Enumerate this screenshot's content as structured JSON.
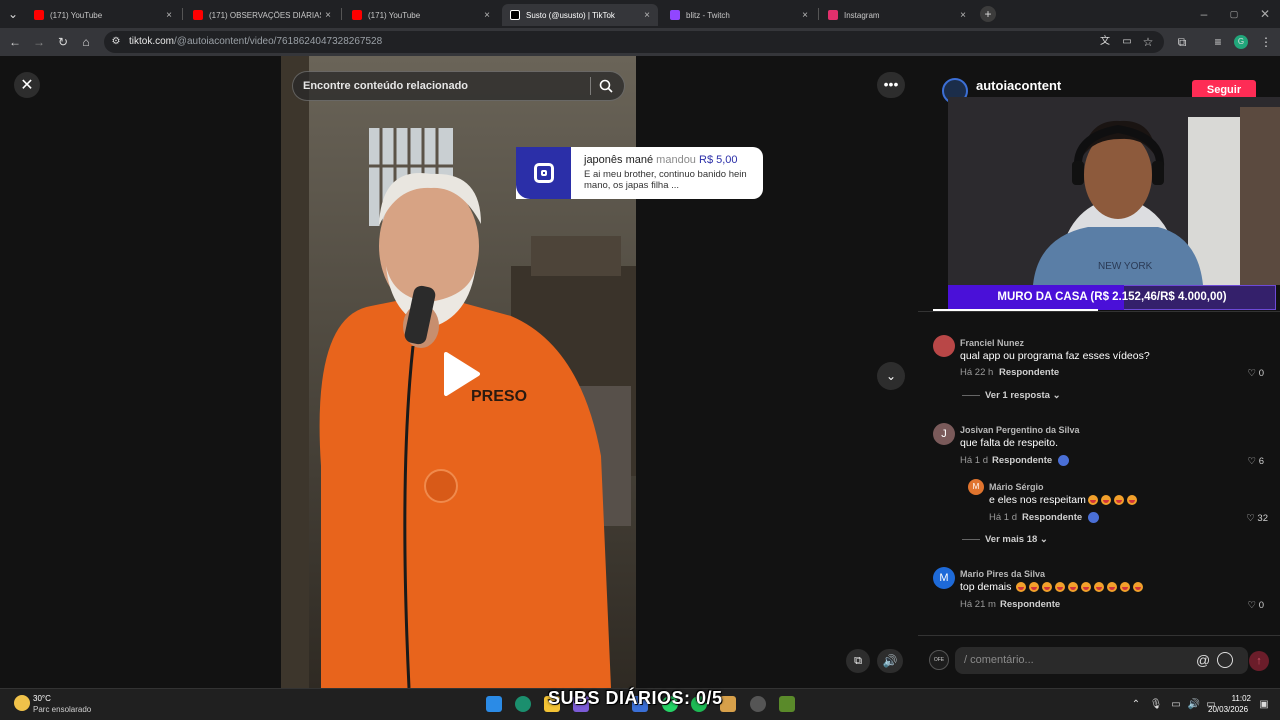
{
  "browser": {
    "tabs": [
      {
        "title": "(171) YouTube",
        "color": "#ff0000",
        "active": false
      },
      {
        "title": "(171) OBSERVAÇÕES DIÁRIAS |",
        "color": "#ff0000",
        "active": false
      },
      {
        "title": "(171) YouTube",
        "color": "#ff0000",
        "active": false
      },
      {
        "title": "Susto (@ususto) | TikTok",
        "color": "#000000",
        "active": true
      },
      {
        "title": "blitz - Twitch",
        "color": "#9146ff",
        "active": false
      },
      {
        "title": "Instagram",
        "color": "#e1306c",
        "active": false
      }
    ],
    "url_host": "tiktok.com",
    "url_path": "/@autoiacontent/video/7618624047328267528"
  },
  "video": {
    "search_placeholder": "Encontre conteúdo relacionado",
    "shirt_text": "PRESO"
  },
  "donation": {
    "name": "japonês mané",
    "action": "mandou",
    "amount": "R$ 5,00",
    "message": "E ai meu brother, continuo banido hein mano, os japas filha ..."
  },
  "panel": {
    "author": "autoiacontent",
    "follow_label": "Seguir",
    "muro": "MURO DA CASA (R$ 2.152,46/R$ 4.000,00)",
    "muro_progress": 0.538
  },
  "comments": [
    {
      "name": "Franciel Nunez",
      "text": "qual app ou programa faz esses vídeos?",
      "time": "Há 22 h",
      "reply": "Respondente",
      "likes": "0",
      "see_more": "Ver 1 resposta"
    },
    {
      "name": "Josivan Pergentino da Silva",
      "initial": "J",
      "text": "que falta de respeito.",
      "time": "Há 1 d",
      "reply": "Respondente",
      "likes": "6"
    },
    {
      "name": "Mário Sérgio",
      "initial": "M",
      "text": "e eles nos respeitam",
      "time": "Há 1 d",
      "reply": "Respondente",
      "likes": "32",
      "see_more": "Ver mais 18"
    },
    {
      "name": "Mario Pires da Silva",
      "initial": "M",
      "text": "top demais",
      "time": "Há 21 m",
      "reply": "Respondente",
      "likes": "0"
    }
  ],
  "comment_input": {
    "placeholder": "/ comentário...",
    "user_tag": "OFE"
  },
  "taskbar": {
    "temp": "30°C",
    "weather": "Parc ensolarado",
    "overlay": "SUBS DIÁRIOS: 0/5",
    "time": "11:02",
    "date": "20/03/2026"
  }
}
